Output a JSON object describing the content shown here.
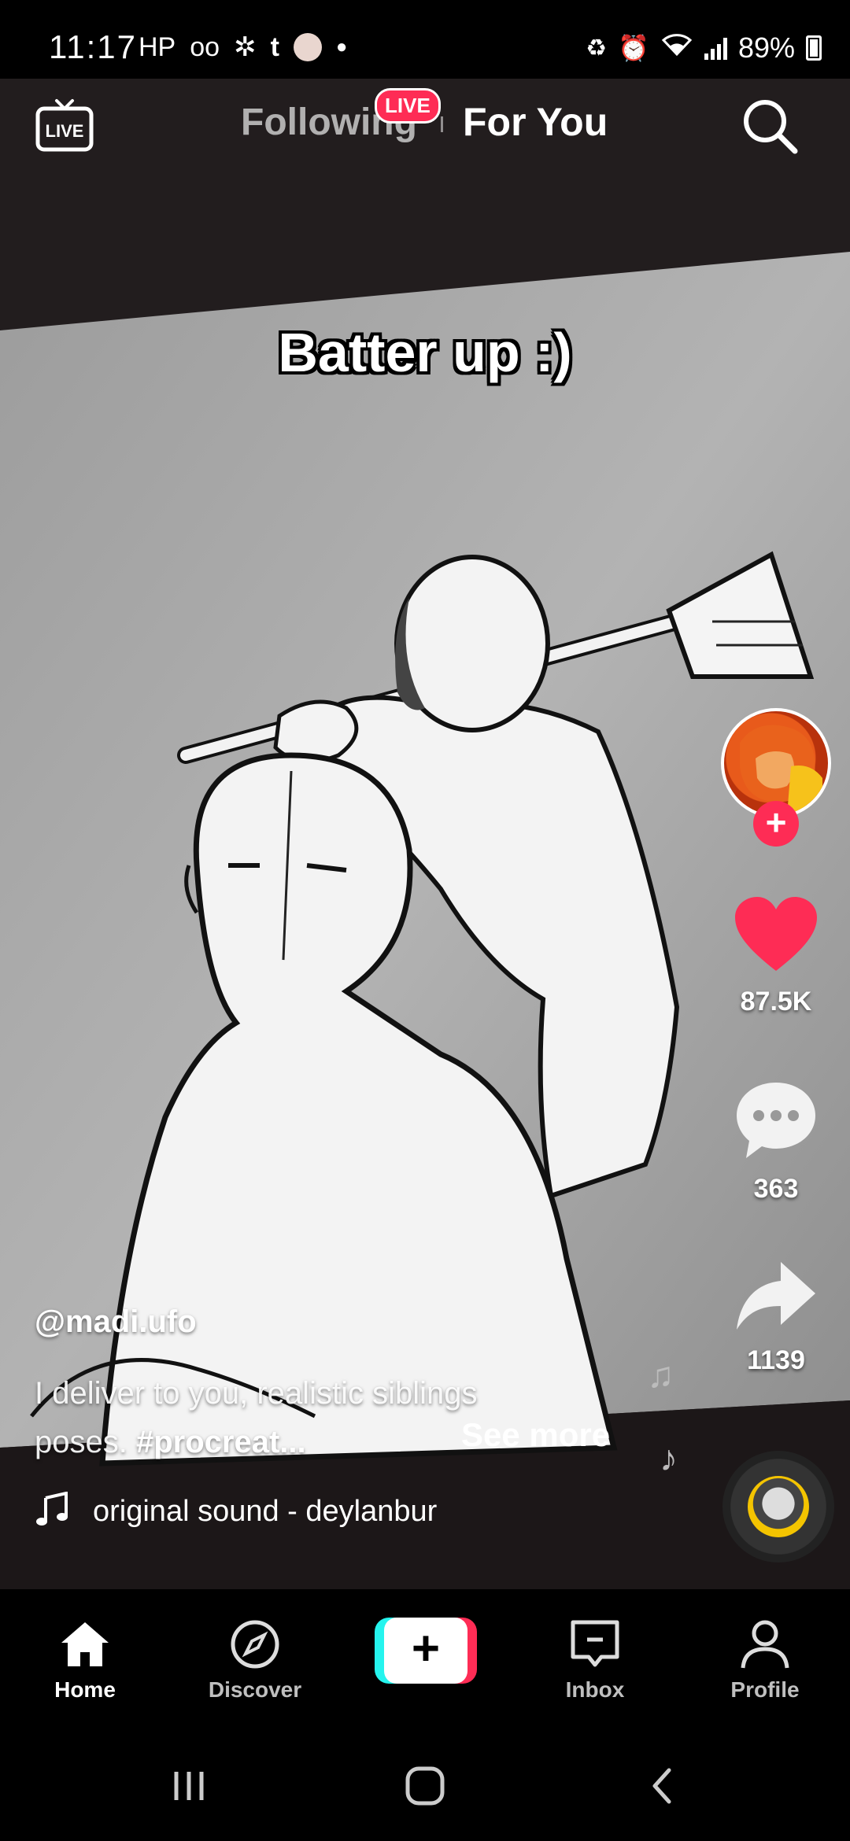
{
  "status_bar": {
    "time": "11:17",
    "notification_icons": [
      "hp-icon",
      "voicemail-icon",
      "pinwheel-icon",
      "tumblr-icon",
      "avatar-notification-icon",
      "dot-icon"
    ],
    "battery": "89%"
  },
  "top_tabs": {
    "live_label": "LIVE",
    "following": "Following",
    "live_badge": "LIVE",
    "for_you": "For You"
  },
  "video": {
    "caption": "Batter up :)"
  },
  "actions": {
    "likes": "87.5K",
    "comments": "363",
    "shares": "1139"
  },
  "post": {
    "username": "@madi.ufo",
    "description": "I deliver to you, realistic siblings poses. ",
    "hashtag": "#procreat...",
    "see_more": "See more",
    "sound": "original sound - deylanbur"
  },
  "bottom_nav": {
    "home": "Home",
    "discover": "Discover",
    "inbox": "Inbox",
    "profile": "Profile"
  },
  "colors": {
    "accent": "#fe2c55",
    "cyan": "#25f4ee",
    "like": "#fe2c55"
  }
}
